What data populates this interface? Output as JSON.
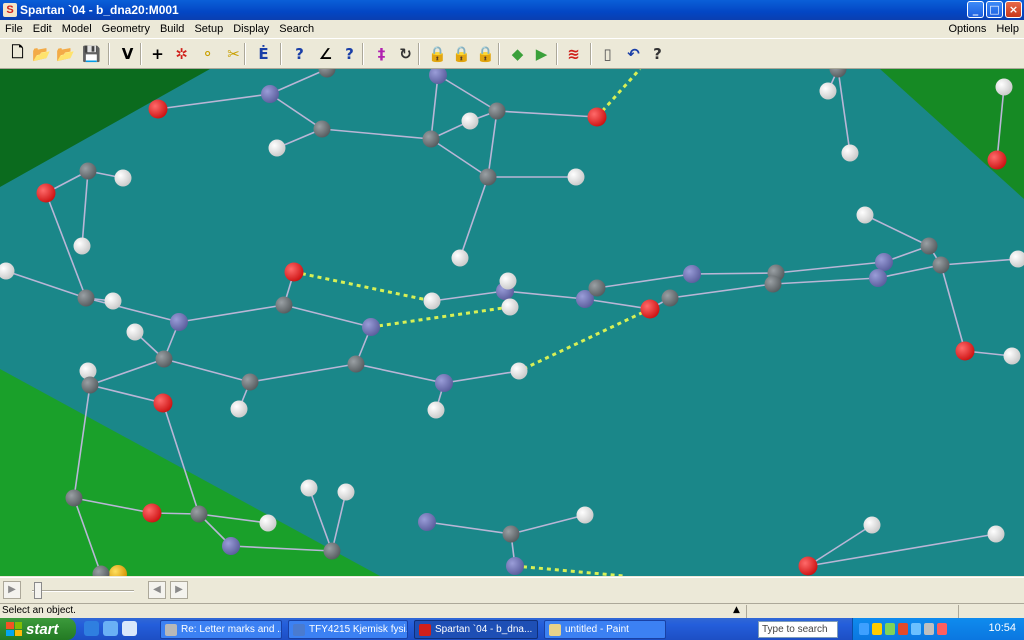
{
  "window": {
    "title": "Spartan `04 - b_dna20:M001",
    "app_icon_letter": "S",
    "buttons": {
      "minimize": "_",
      "maximize": "□",
      "close": "×"
    }
  },
  "menu": {
    "left": [
      "File",
      "Edit",
      "Model",
      "Geometry",
      "Build",
      "Setup",
      "Display",
      "Search"
    ],
    "right": [
      "Options",
      "Help"
    ]
  },
  "toolbar": {
    "tools": [
      {
        "name": "new-file-icon",
        "glyph": "🗋"
      },
      {
        "name": "open-folder-icon",
        "glyph": "📂"
      },
      {
        "name": "open-folder-alt-icon",
        "glyph": "📂"
      },
      {
        "name": "save-disk-icon",
        "glyph": "💾"
      },
      {
        "name": "view-tool-icon",
        "glyph": "V"
      },
      {
        "name": "add-fragment-icon",
        "glyph": "+"
      },
      {
        "name": "delete-atom-icon",
        "glyph": "✲"
      },
      {
        "name": "make-bond-icon",
        "glyph": "⚬"
      },
      {
        "name": "break-bond-icon",
        "glyph": "✂"
      },
      {
        "name": "minimize-energy-icon",
        "glyph": "Ė"
      },
      {
        "name": "measure-distance-icon",
        "glyph": "?"
      },
      {
        "name": "measure-angle-icon",
        "glyph": "∠"
      },
      {
        "name": "measure-dihedral-icon",
        "glyph": "?"
      },
      {
        "name": "constrain-distance-icon",
        "glyph": "‡"
      },
      {
        "name": "constrain-angle-icon",
        "glyph": "↻"
      },
      {
        "name": "freeze-center-icon",
        "glyph": "🔒"
      },
      {
        "name": "freeze-angle-icon",
        "glyph": "🔒"
      },
      {
        "name": "freeze-dihedral-icon",
        "glyph": "🔒"
      },
      {
        "name": "define-point-icon",
        "glyph": "◆"
      },
      {
        "name": "define-plane-icon",
        "glyph": "▶"
      },
      {
        "name": "surface-heat-icon",
        "glyph": "≋"
      },
      {
        "name": "copy-clipboard-icon",
        "glyph": "▯"
      },
      {
        "name": "undo-arrow-icon",
        "glyph": "↶"
      },
      {
        "name": "select-pointer-icon",
        "glyph": "?"
      }
    ]
  },
  "status": {
    "message": "Select an object."
  },
  "playback": {
    "back": "◀",
    "forward": "▶",
    "play": "▶",
    "position": 0
  },
  "taskbar": {
    "start_label": "start",
    "tasks": [
      {
        "label": "Re: Letter marks and ...",
        "color": "#b8b8b8"
      },
      {
        "label": "TFY4215 Kjemisk fysi...",
        "color": "#4a7bd0"
      },
      {
        "label": "Spartan `04 - b_dna...",
        "color": "#d0201a"
      },
      {
        "label": "untitled - Paint",
        "color": "#e8d28a"
      }
    ],
    "search_placeholder": "Type to search",
    "clock": "10:54"
  },
  "colors": {
    "viewport_bg": "#1a8789",
    "carbon": "#555b5e",
    "hydrogen": "#e8e8e8",
    "nitrogen": "#5a5d9c",
    "oxygen": "#cc1111",
    "hbond": "#d8f055"
  }
}
